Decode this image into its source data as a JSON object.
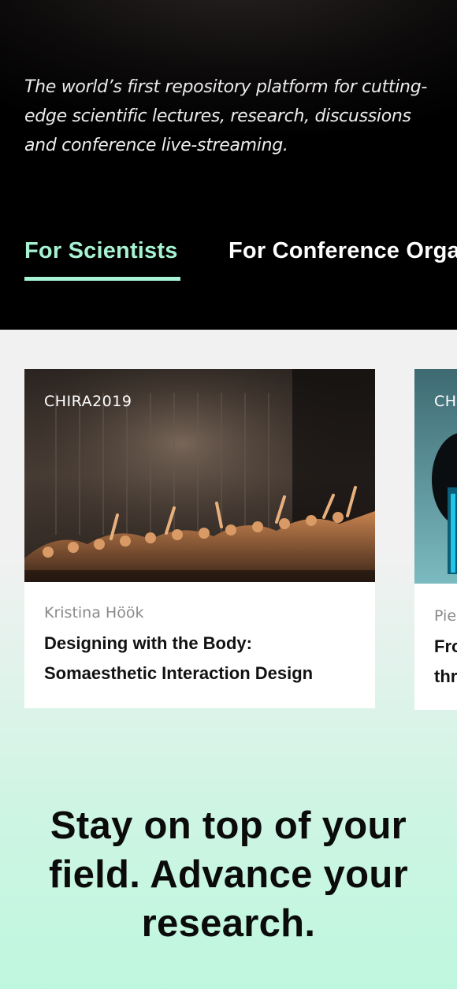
{
  "hero": {
    "tagline": "The world’s first repository platform for cutting-edge scientific lectures, research, discussions and conference live-streaming."
  },
  "tabs": [
    {
      "label": "For Scientists",
      "active": true
    },
    {
      "label": "For Conference Orga",
      "active": false
    }
  ],
  "cards": [
    {
      "tag": "CHIRA2019",
      "author": "Kristina Höök",
      "title": "Designing with the Body: Somaesthetic Interaction Design"
    },
    {
      "tag": "CH",
      "author": "Pie",
      "title_line1": "Fro",
      "title_line2": "thr"
    }
  ],
  "headline": "Stay on top of your field. Advance your research.",
  "colors": {
    "accent": "#a6f2d2",
    "hero_bg": "#000000",
    "page_bg": "#f1f1f1",
    "bottom_bg": "#bff7de"
  }
}
